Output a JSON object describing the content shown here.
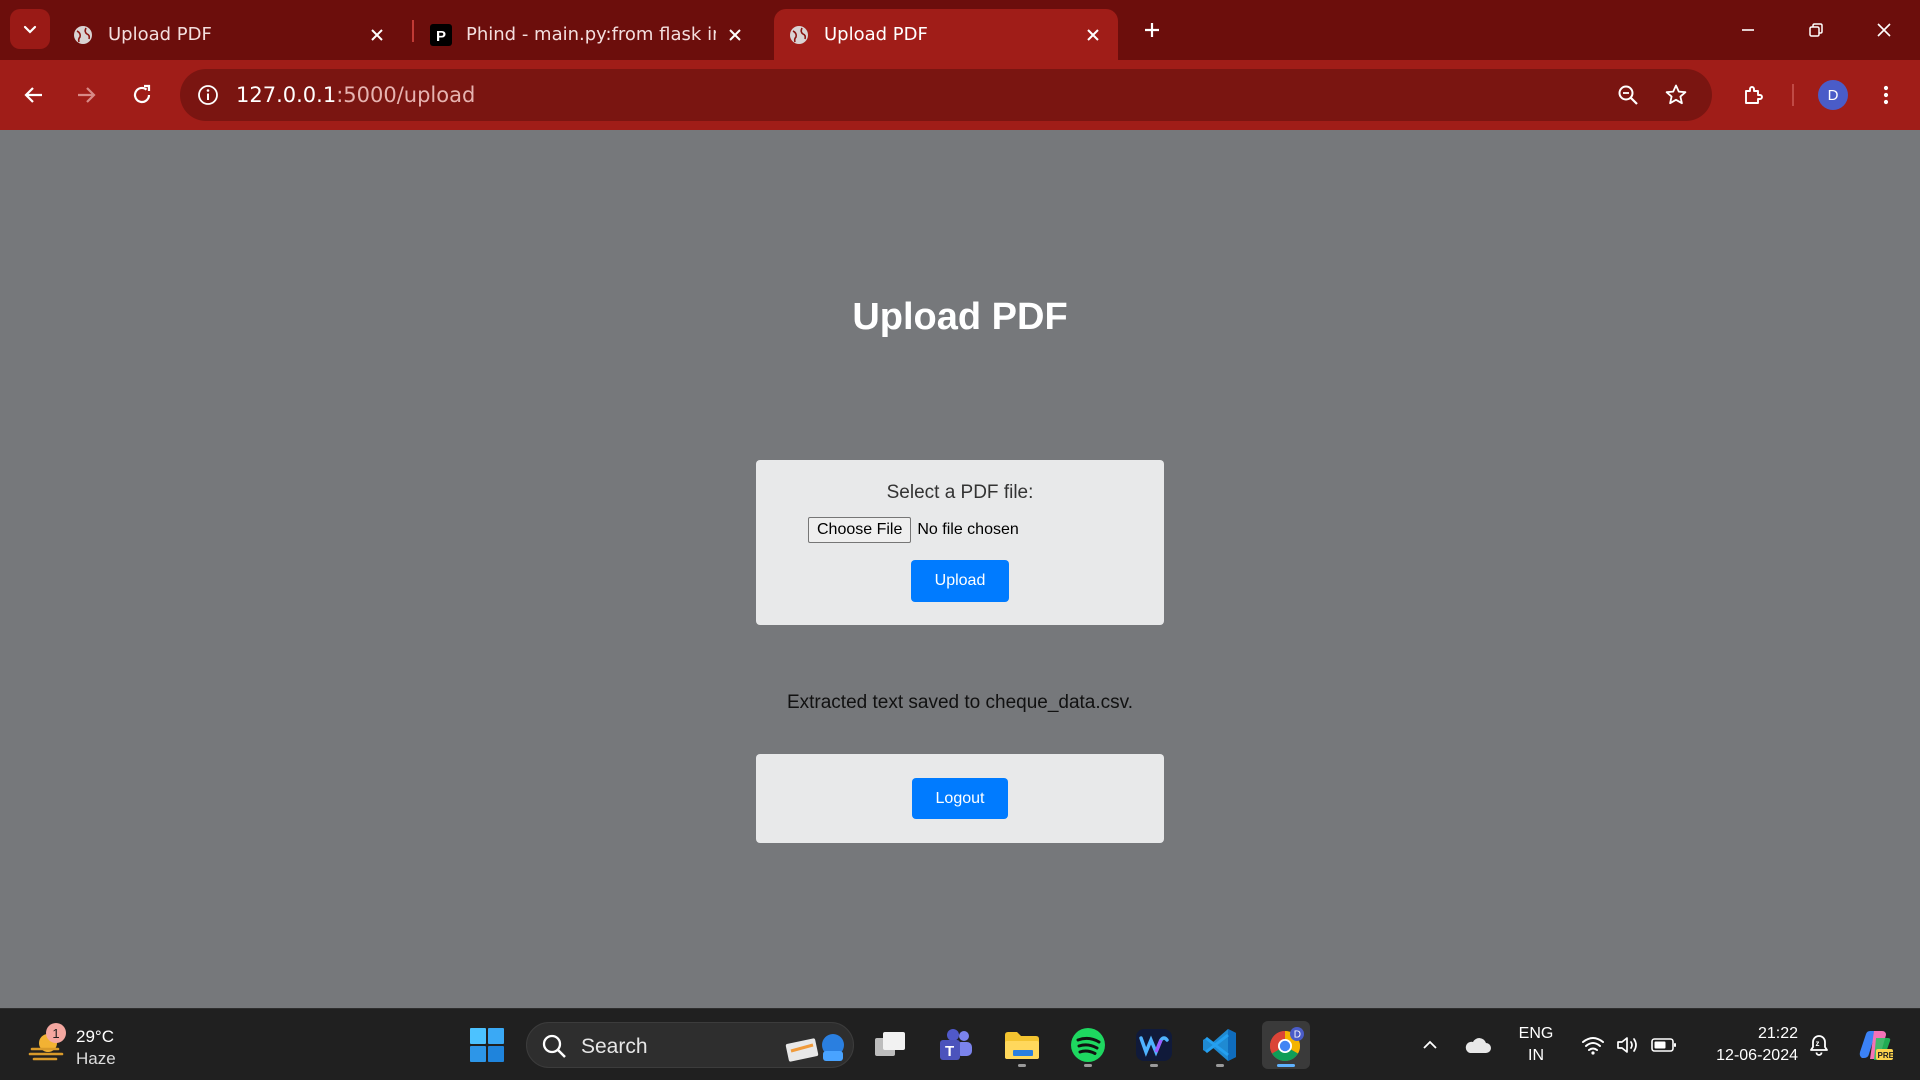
{
  "browser": {
    "tabs": [
      {
        "title": "Upload PDF",
        "active": false
      },
      {
        "title": "Phind - main.py:from flask import",
        "active": false
      },
      {
        "title": "Upload PDF",
        "active": true
      }
    ],
    "address": {
      "host": "127.0.0.1",
      "path": ":5000/upload"
    },
    "profile_initial": "D"
  },
  "page": {
    "title": "Upload PDF",
    "file_label": "Select a PDF file:",
    "choose_file": "Choose File",
    "no_file": "No file chosen",
    "upload_label": "Upload",
    "message": "Extracted text saved to cheque_data.csv.",
    "logout_label": "Logout",
    "button_color": "#007bff"
  },
  "taskbar": {
    "weather": {
      "temp": "29°C",
      "condition": "Haze",
      "badge": "1"
    },
    "search_placeholder": "Search",
    "apps": [
      "windows-start",
      "search",
      "task-view",
      "teams",
      "file-explorer",
      "spotify",
      "webex",
      "vscode",
      "chrome"
    ],
    "language": {
      "line1": "ENG",
      "line2": "IN"
    },
    "time": "21:22",
    "date": "12-06-2024"
  }
}
